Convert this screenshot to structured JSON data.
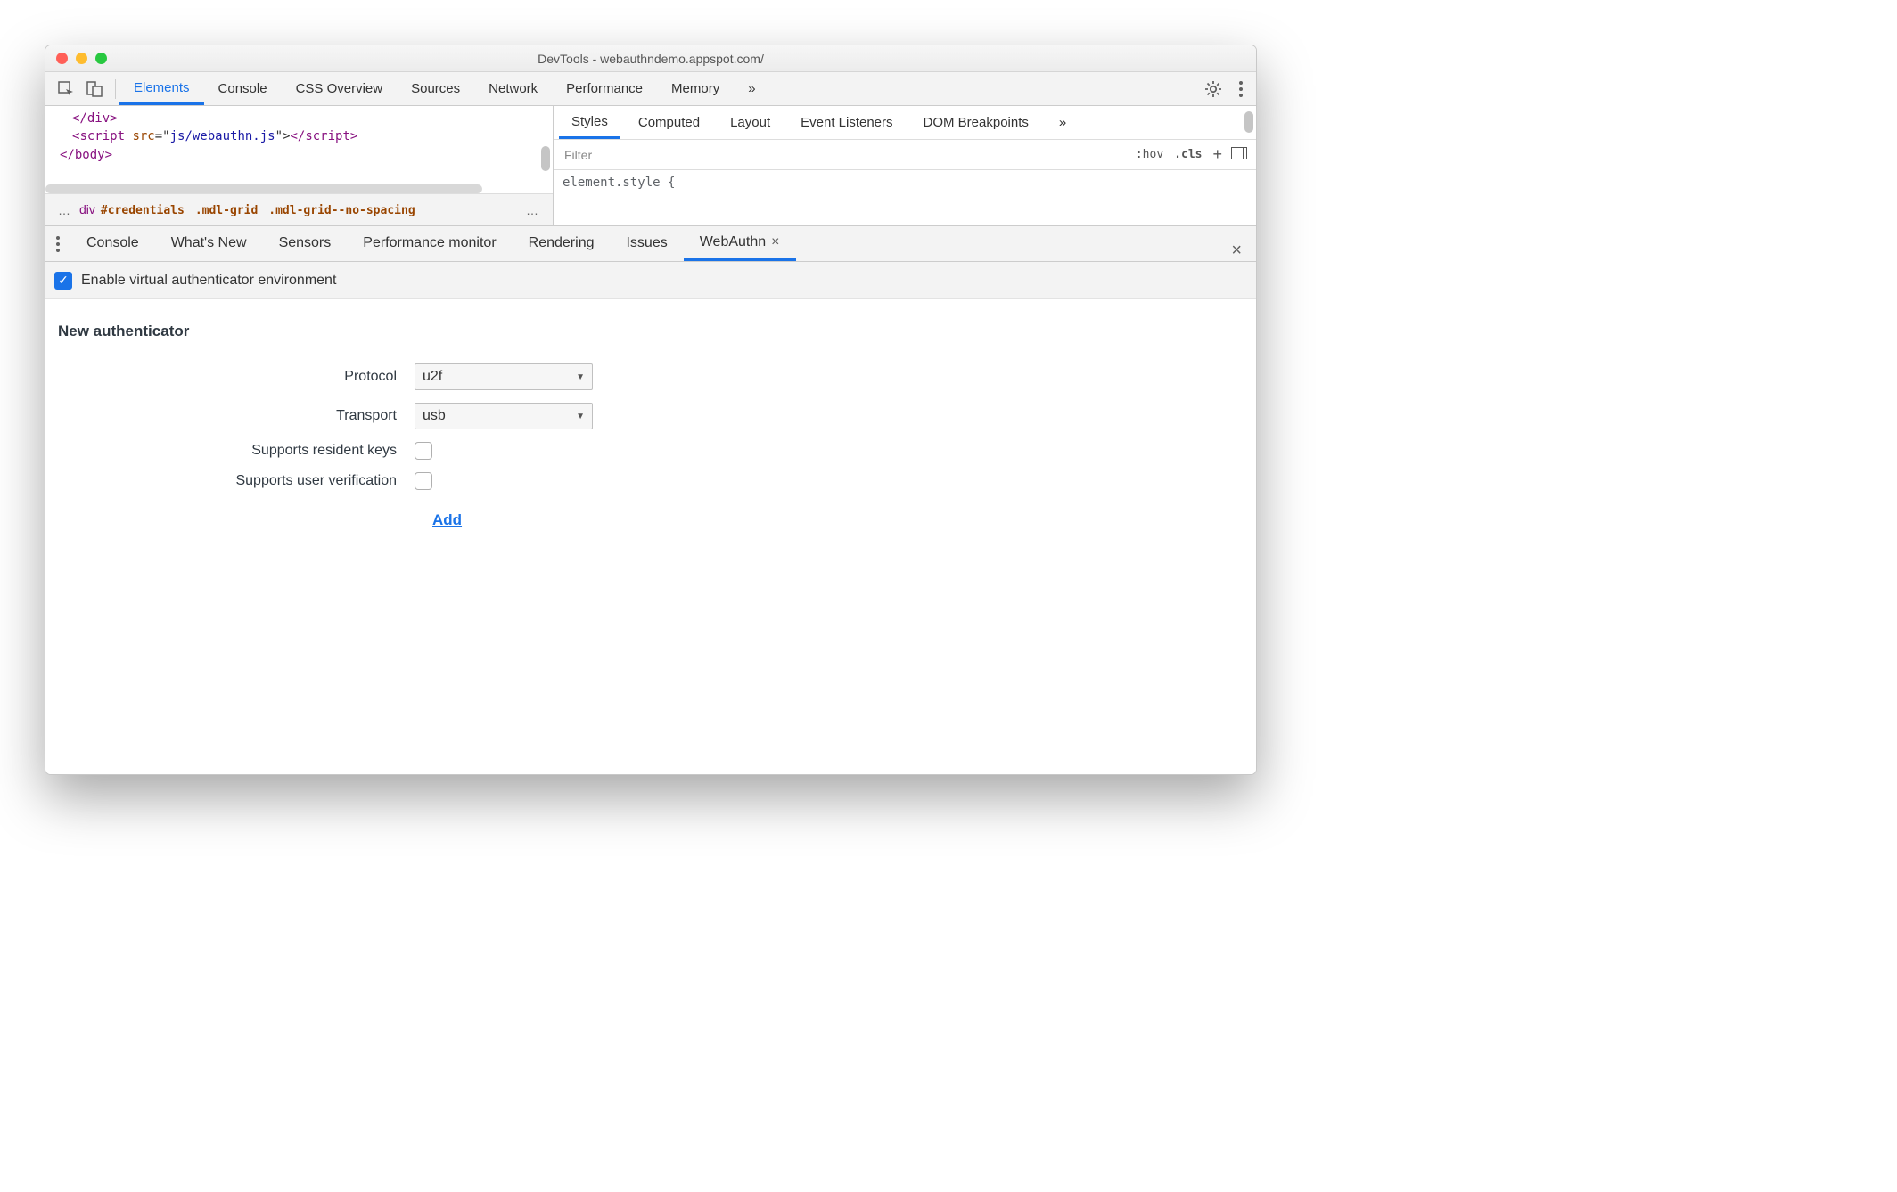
{
  "title": "DevTools - webauthndemo.appspot.com/",
  "mainTabs": {
    "elements": "Elements",
    "console": "Console",
    "cssOverview": "CSS Overview",
    "sources": "Sources",
    "network": "Network",
    "performance": "Performance",
    "memory": "Memory",
    "overflow": "»"
  },
  "codeLines": {
    "l1a": "</",
    "l1b": "div",
    "l1c": ">",
    "l2a": "<",
    "l2b": "script",
    "l2c": " src",
    "l2d": "=\"",
    "l2e": "js/webauthn.js",
    "l2f": "\">",
    "l2g": "</",
    "l2h": "script",
    "l2i": ">",
    "l3a": "</",
    "l3b": "body",
    "l3c": ">"
  },
  "breadcrumb": {
    "dots": "…",
    "tag": "div",
    "id": "#credentials",
    "cls1": ".mdl-grid",
    "cls2": ".mdl-grid--no-spacing",
    "dots2": "…"
  },
  "sidePanel": {
    "tabs": {
      "styles": "Styles",
      "computed": "Computed",
      "layout": "Layout",
      "listeners": "Event Listeners",
      "dom": "DOM Breakpoints",
      "overflow": "»"
    },
    "filterPlaceholder": "Filter",
    "hov": ":hov",
    "cls": ".cls",
    "styleBody": "element.style {"
  },
  "drawer": {
    "tabs": {
      "console": "Console",
      "whatsnew": "What's New",
      "sensors": "Sensors",
      "perfmon": "Performance monitor",
      "rendering": "Rendering",
      "issues": "Issues",
      "webauthn": "WebAuthn"
    }
  },
  "enable": {
    "label": "Enable virtual authenticator environment"
  },
  "form": {
    "heading": "New authenticator",
    "protocolLabel": "Protocol",
    "protocolValue": "u2f",
    "transportLabel": "Transport",
    "transportValue": "usb",
    "residentLabel": "Supports resident keys",
    "userVerLabel": "Supports user verification",
    "add": "Add"
  }
}
